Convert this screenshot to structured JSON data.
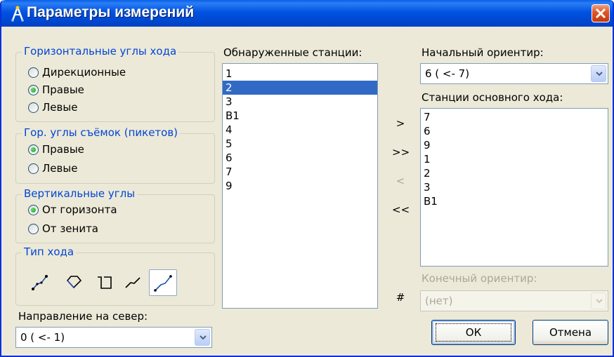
{
  "window": {
    "title": "Параметры измерений"
  },
  "horiz_group": {
    "legend": "Горизонтальные углы хода",
    "options": [
      "Дирекционные",
      "Правые",
      "Левые"
    ],
    "selected": "Правые"
  },
  "shots_group": {
    "legend": "Гор. углы съёмок (пикетов)",
    "options": [
      "Правые",
      "Левые"
    ],
    "selected": "Правые"
  },
  "vert_group": {
    "legend": "Вертикальные углы",
    "options": [
      "От горизонта",
      "От зенита"
    ],
    "selected": "От горизонта"
  },
  "traverse_type": {
    "legend": "Тип хода",
    "icons": [
      "open-traverse-icon",
      "closed-polygon-icon",
      "rectangle-traverse-icon",
      "hanging-traverse-icon",
      "connected-traverse-icon"
    ],
    "selected": "connected-traverse-icon"
  },
  "north_direction": {
    "label": "Направление на север:",
    "value": "0 ( <- 1)"
  },
  "found_stations": {
    "label": "Обнаруженные станции:",
    "items": [
      "1",
      "2",
      "3",
      "B1",
      "4",
      "5",
      "6",
      "7",
      "9"
    ],
    "selected": "2"
  },
  "move_buttons": {
    "add": ">",
    "add_all": ">>",
    "remove": "<",
    "remove_all": "<<",
    "hash": "#"
  },
  "start_orient": {
    "label": "Начальный ориентир:",
    "value": "6 ( <- 7)"
  },
  "main_stations": {
    "label": "Станции основного хода:",
    "items": [
      "7",
      "6",
      "9",
      "1",
      "2",
      "3",
      "B1"
    ]
  },
  "end_orient": {
    "label": "Конечный ориентир:",
    "value": "(нет)"
  },
  "buttons": {
    "ok": "ОК",
    "cancel": "Отмена"
  },
  "colors": {
    "title_blue": "#0052e1",
    "legend_blue": "#0046d5",
    "selection": "#316ac5",
    "close_red": "#e05a2a"
  }
}
